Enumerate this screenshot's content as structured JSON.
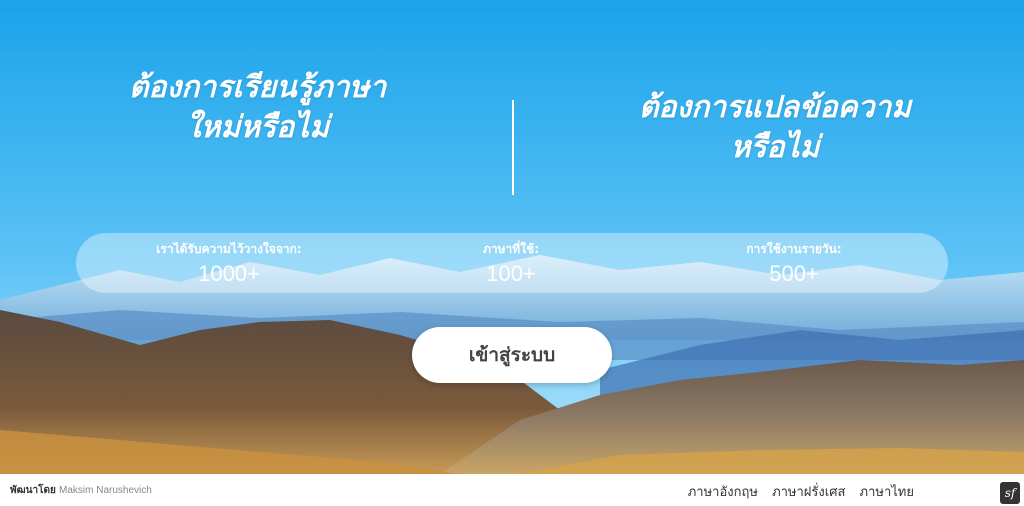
{
  "hero": {
    "left_headline": "ต้องการเรียนรู้ภาษาใหม่หรือไม่",
    "right_headline": "ต้องการแปลข้อความหรือไม่"
  },
  "stats": [
    {
      "label": "เราได้รับความไว้วางใจจาก:",
      "value": "1000+"
    },
    {
      "label": "ภาษาที่ใช้:",
      "value": "100+"
    },
    {
      "label": "การใช้งานรายวัน:",
      "value": "500+"
    }
  ],
  "cta": {
    "label": "เข้าสู่ระบบ"
  },
  "footer": {
    "credit_prefix": "พัฒนาโดย",
    "credit_name": "Maksim Narushevich",
    "languages": [
      "ภาษาอังกฤษ",
      "ภาษาฝรั่งเศส",
      "ภาษาไทย"
    ],
    "badge": "sf"
  },
  "colors": {
    "sky_top": "#1FA7EA",
    "sky_bottom": "#8FD6FA",
    "mountain_dark": "#4a3a32",
    "hill_gold": "#c9943f"
  }
}
